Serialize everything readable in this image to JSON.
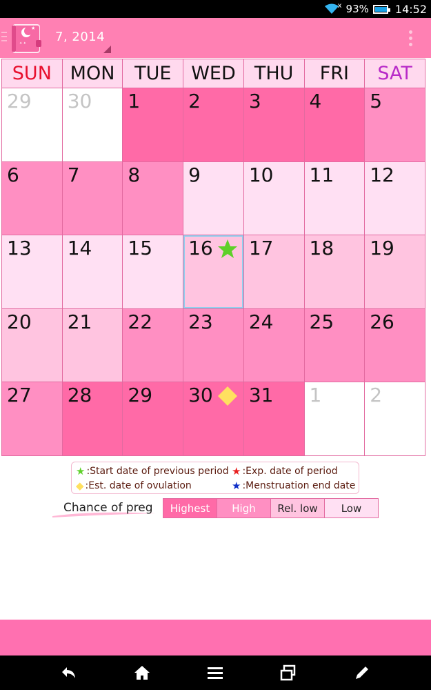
{
  "status_bar": {
    "battery_percent_label": "93%",
    "battery_level": 0.93,
    "time": "14:52",
    "icons": [
      "wifi-icon",
      "battery-icon"
    ]
  },
  "app_bar": {
    "month_label": "7, 2014",
    "icons": [
      "menu-icon",
      "app-diary-icon",
      "overflow-menu-icon"
    ]
  },
  "weekdays": [
    "SUN",
    "MON",
    "TUE",
    "WED",
    "THU",
    "FRI",
    "SAT"
  ],
  "colors": {
    "appbar": "#ff80b3",
    "highest": "#ff6aa7",
    "high": "#ff8fc2",
    "rel_low": "#ffc4e0",
    "low": "#ffe0f3",
    "other": "#ffffff",
    "sun": "#e8102e",
    "sat": "#b82ac8"
  },
  "days": [
    {
      "label": "29",
      "level": "other"
    },
    {
      "label": "30",
      "level": "other"
    },
    {
      "label": "1",
      "level": "highest"
    },
    {
      "label": "2",
      "level": "highest"
    },
    {
      "label": "3",
      "level": "highest"
    },
    {
      "label": "4",
      "level": "highest"
    },
    {
      "label": "5",
      "level": "high"
    },
    {
      "label": "6",
      "level": "high"
    },
    {
      "label": "7",
      "level": "high"
    },
    {
      "label": "8",
      "level": "high"
    },
    {
      "label": "9",
      "level": "low"
    },
    {
      "label": "10",
      "level": "low"
    },
    {
      "label": "11",
      "level": "low"
    },
    {
      "label": "12",
      "level": "low"
    },
    {
      "label": "13",
      "level": "low"
    },
    {
      "label": "14",
      "level": "low"
    },
    {
      "label": "15",
      "level": "low"
    },
    {
      "label": "16",
      "level": "rel_low",
      "today": true,
      "mark": "green-star"
    },
    {
      "label": "17",
      "level": "rel_low"
    },
    {
      "label": "18",
      "level": "rel_low"
    },
    {
      "label": "19",
      "level": "rel_low"
    },
    {
      "label": "20",
      "level": "rel_low"
    },
    {
      "label": "21",
      "level": "rel_low"
    },
    {
      "label": "22",
      "level": "high"
    },
    {
      "label": "23",
      "level": "high"
    },
    {
      "label": "24",
      "level": "high"
    },
    {
      "label": "25",
      "level": "high"
    },
    {
      "label": "26",
      "level": "high"
    },
    {
      "label": "27",
      "level": "high"
    },
    {
      "label": "28",
      "level": "highest"
    },
    {
      "label": "29",
      "level": "highest"
    },
    {
      "label": "30",
      "level": "highest",
      "mark": "yellow-diamond"
    },
    {
      "label": "31",
      "level": "highest"
    },
    {
      "label": "1",
      "level": "other"
    },
    {
      "label": "2",
      "level": "other"
    }
  ],
  "legend": {
    "start_prev": {
      "symbol": "★",
      "color": "#5fd02a",
      "text": ":Start date of previous period"
    },
    "exp_period": {
      "symbol": "★",
      "color": "#e82020",
      "text": ":Exp. date of period"
    },
    "ovulation": {
      "symbol": "◆",
      "color": "#ffe060",
      "text": ":Est. date of ovulation"
    },
    "menstruation_end": {
      "symbol": "★",
      "color": "#1030c8",
      "text": ":Menstruation end date"
    }
  },
  "chance": {
    "label": "Chance of preg",
    "levels": [
      {
        "text": "Highest",
        "bg": "#ff6aa7",
        "fg": "#ffffff"
      },
      {
        "text": "High",
        "bg": "#ff8fc2",
        "fg": "#ffffff"
      },
      {
        "text": "Rel. low",
        "bg": "#ffc4e0",
        "fg": "#222222"
      },
      {
        "text": "Low",
        "bg": "#ffe0f3",
        "fg": "#222222"
      }
    ]
  },
  "nav_bar": {
    "icons": [
      "back-icon",
      "home-icon",
      "menu-lines-icon",
      "recent-apps-icon",
      "edit-icon"
    ]
  }
}
